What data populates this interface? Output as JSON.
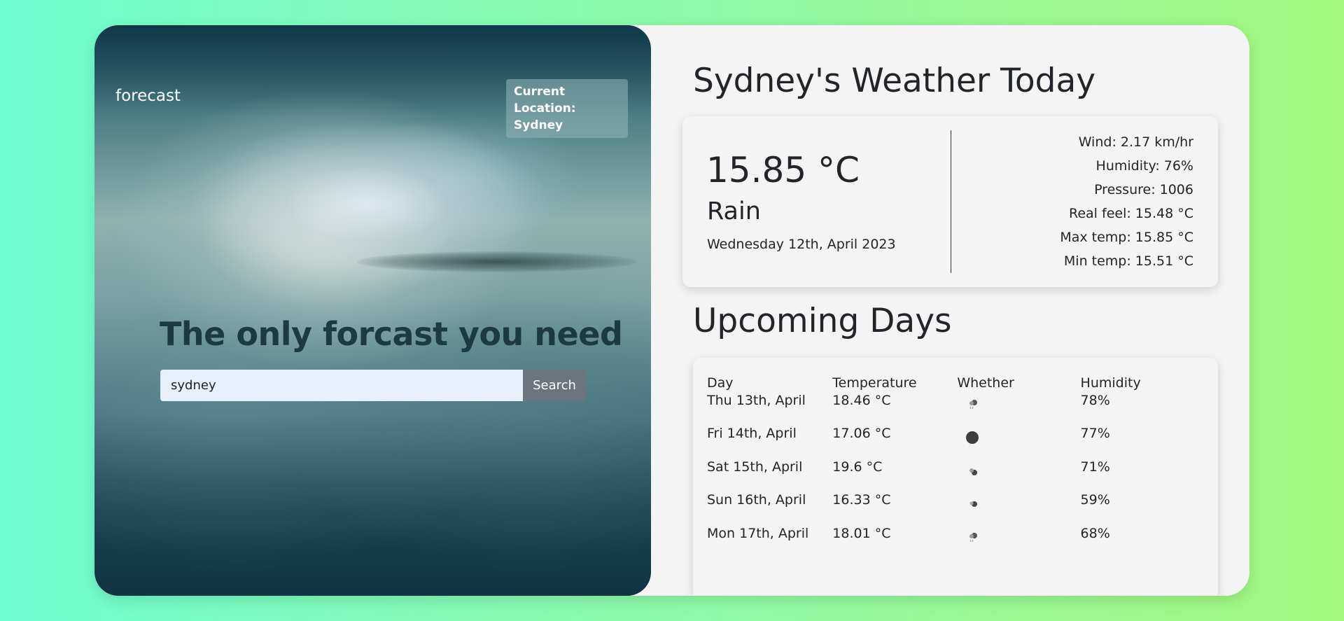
{
  "hero": {
    "brand": "forecast",
    "location_label": "Current Location:",
    "location_value": "Sydney",
    "title": "The only forcast you need",
    "search_value": "sydney",
    "search_button": "Search"
  },
  "today": {
    "heading": "Sydney's Weather Today",
    "temperature": "15.85 °C",
    "condition": "Rain",
    "date": "Wednesday 12th, April 2023",
    "stats": {
      "wind": "Wind: 2.17 km/hr",
      "humidity": "Humidity: 76%",
      "pressure": "Pressure: 1006",
      "real_feel": "Real feel: 15.48 °C",
      "max_temp": "Max temp: 15.85 °C",
      "min_temp": "Min temp: 15.51 °C"
    }
  },
  "upcoming": {
    "heading": "Upcoming Days",
    "columns": [
      "Day",
      "Temperature",
      "Whether",
      "Humidity"
    ],
    "rows": [
      {
        "day": "Thu 13th, April",
        "temperature": "18.46 °C",
        "icon": "rain-icon",
        "humidity": "78%"
      },
      {
        "day": "Fri 14th, April",
        "temperature": "17.06 °C",
        "icon": "overcast-icon",
        "humidity": "77%"
      },
      {
        "day": "Sat 15th, April",
        "temperature": "19.6 °C",
        "icon": "broken-clouds-icon",
        "humidity": "71%"
      },
      {
        "day": "Sun 16th, April",
        "temperature": "16.33 °C",
        "icon": "scattered-clouds-icon",
        "humidity": "59%"
      },
      {
        "day": "Mon 17th, April",
        "temperature": "18.01 °C",
        "icon": "rain-icon",
        "humidity": "68%"
      }
    ]
  },
  "colors": {
    "page_gradient_start": "#6ffcd0",
    "page_gradient_end": "#a3f77d",
    "card_bg": "#f4f4f4",
    "search_button": "#6c757d",
    "hero_title": "#1d3a44"
  }
}
